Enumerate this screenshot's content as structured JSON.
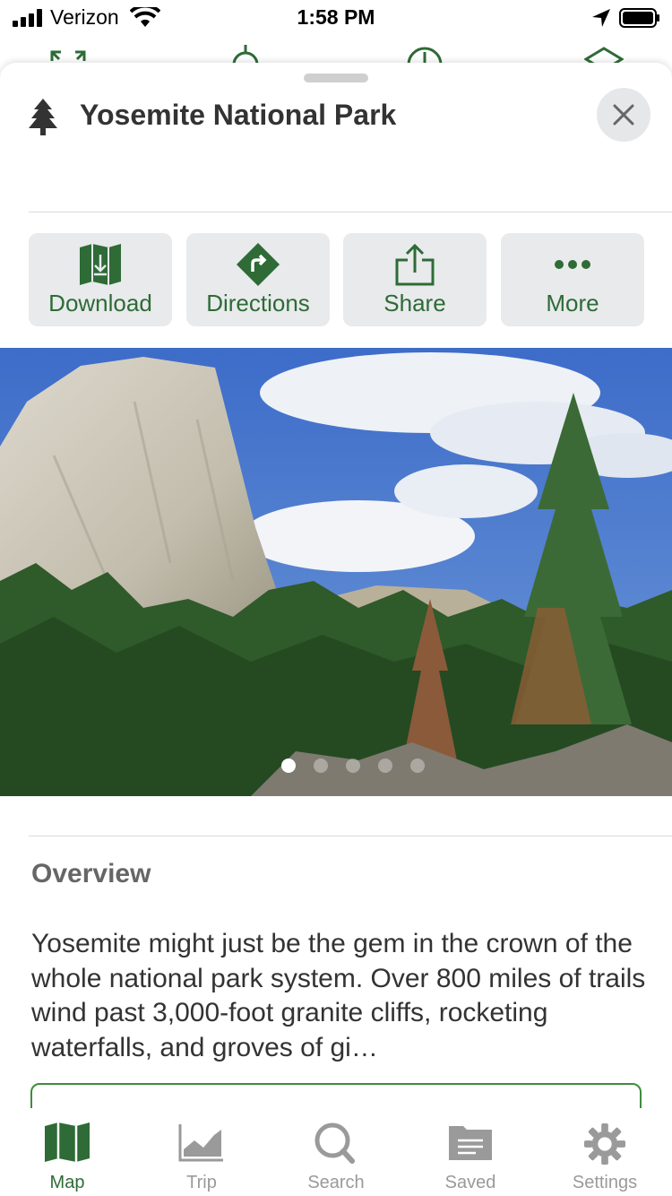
{
  "status_bar": {
    "carrier": "Verizon",
    "time": "1:58 PM"
  },
  "colors": {
    "brand_green": "#2e6b36",
    "button_bg": "#e8eaec",
    "inactive_tab": "#9a9a9a"
  },
  "sheet": {
    "title": "Yosemite National Park",
    "title_icon": "pine-tree-icon",
    "actions": [
      {
        "label": "Download",
        "icon": "map-download-icon"
      },
      {
        "label": "Directions",
        "icon": "directions-icon"
      },
      {
        "label": "Share",
        "icon": "share-icon"
      },
      {
        "label": "More",
        "icon": "more-dots-icon"
      }
    ],
    "photo": {
      "page_count": 5,
      "active_page": 1
    },
    "overview": {
      "heading": "Overview",
      "text": "Yosemite might just be the gem in the crown of the whole national park system. Over 800 miles of trails wind past 3,000-foot granite cliffs, rocketing waterfalls, and groves of gi…"
    }
  },
  "tabbar": {
    "tabs": [
      {
        "label": "Map",
        "icon": "map-icon",
        "active": true
      },
      {
        "label": "Trip",
        "icon": "chart-icon",
        "active": false
      },
      {
        "label": "Search",
        "icon": "search-icon",
        "active": false
      },
      {
        "label": "Saved",
        "icon": "saved-folder-icon",
        "active": false
      },
      {
        "label": "Settings",
        "icon": "gear-icon",
        "active": false
      }
    ]
  }
}
